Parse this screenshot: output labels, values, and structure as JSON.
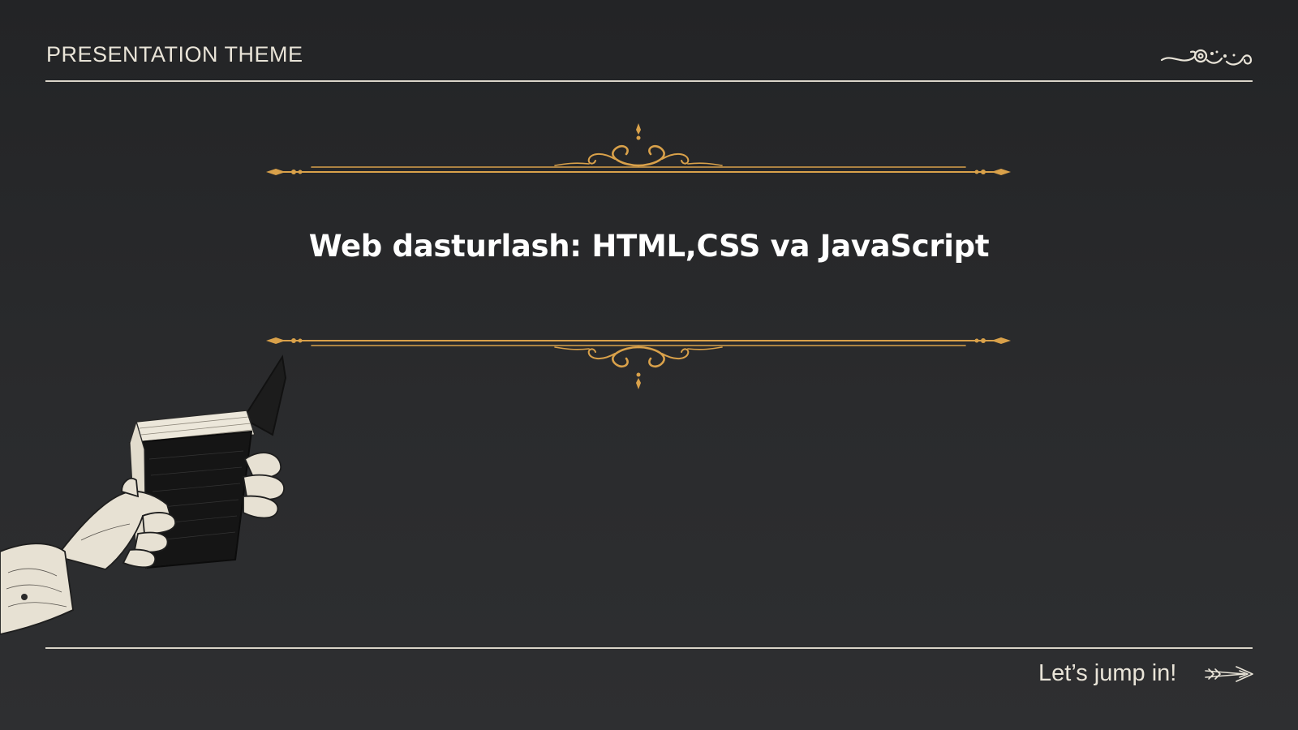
{
  "header": {
    "label": "PRESENTATION THEME"
  },
  "main": {
    "title": "Web dasturlash: HTML,CSS va JavaScript"
  },
  "footer": {
    "cta_label": "Let’s jump in!"
  },
  "colors": {
    "background": "#262729",
    "gold": "#d9a14a",
    "cream": "#e9e4d8",
    "title": "#ffffff"
  },
  "icons": {
    "corner": "swirl-flourish-icon",
    "divider": "ornamental-divider-icon",
    "cta": "arrow-right-icon",
    "illustration": "hand-holding-book-illustration"
  }
}
